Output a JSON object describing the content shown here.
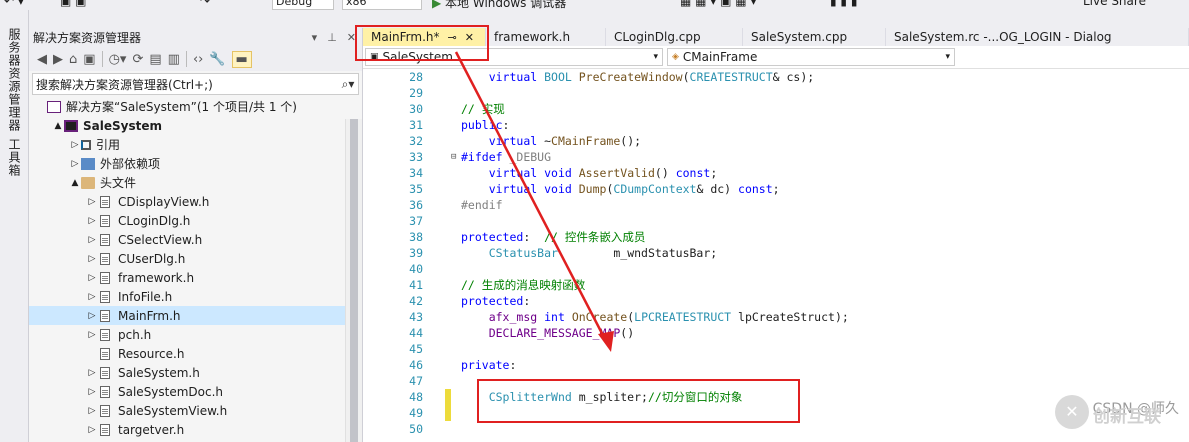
{
  "toolbar": {
    "config": "Debug",
    "platform": "x86",
    "debugger": "本地 Windows 调试器",
    "liveshare": "Live Share"
  },
  "left_tabs": [
    "服务器资源管理器",
    "工具箱"
  ],
  "solution_explorer": {
    "title": "解决方案资源管理器",
    "search_placeholder": "搜索解决方案资源管理器(Ctrl+;)",
    "items": [
      {
        "label": "解决方案“SaleSystem”(1 个项目/共 1 个)",
        "icon": "solution-icon",
        "indent": 0,
        "arrow": ""
      },
      {
        "label": "SaleSystem",
        "icon": "project-icon",
        "indent": 1,
        "arrow": "▲",
        "bold": true
      },
      {
        "label": "引用",
        "icon": "references-icon",
        "indent": 2,
        "arrow": "▷"
      },
      {
        "label": "外部依赖项",
        "icon": "external-deps-icon",
        "indent": 2,
        "arrow": "▷"
      },
      {
        "label": "头文件",
        "icon": "folder-icon",
        "indent": 2,
        "arrow": "▲"
      },
      {
        "label": "CDisplayView.h",
        "icon": "header-file-icon",
        "indent": 3,
        "arrow": "▷"
      },
      {
        "label": "CLoginDlg.h",
        "icon": "header-file-icon",
        "indent": 3,
        "arrow": "▷"
      },
      {
        "label": "CSelectView.h",
        "icon": "header-file-icon",
        "indent": 3,
        "arrow": "▷"
      },
      {
        "label": "CUserDlg.h",
        "icon": "header-file-icon",
        "indent": 3,
        "arrow": "▷"
      },
      {
        "label": "framework.h",
        "icon": "header-file-icon",
        "indent": 3,
        "arrow": "▷"
      },
      {
        "label": "InfoFile.h",
        "icon": "header-file-icon",
        "indent": 3,
        "arrow": "▷"
      },
      {
        "label": "MainFrm.h",
        "icon": "header-file-icon",
        "indent": 3,
        "arrow": "▷",
        "selected": true
      },
      {
        "label": "pch.h",
        "icon": "header-file-icon",
        "indent": 3,
        "arrow": "▷"
      },
      {
        "label": "Resource.h",
        "icon": "header-file-icon",
        "indent": 3,
        "arrow": ""
      },
      {
        "label": "SaleSystem.h",
        "icon": "header-file-icon",
        "indent": 3,
        "arrow": "▷"
      },
      {
        "label": "SaleSystemDoc.h",
        "icon": "header-file-icon",
        "indent": 3,
        "arrow": "▷"
      },
      {
        "label": "SaleSystemView.h",
        "icon": "header-file-icon",
        "indent": 3,
        "arrow": "▷"
      },
      {
        "label": "targetver.h",
        "icon": "header-file-icon",
        "indent": 3,
        "arrow": "▷"
      }
    ]
  },
  "editor": {
    "tabs": [
      {
        "label": "MainFrm.h*",
        "active": true,
        "pin": "⊸",
        "close": "✕"
      },
      {
        "label": "framework.h"
      },
      {
        "label": "CLoginDlg.cpp"
      },
      {
        "label": "SaleSystem.cpp"
      },
      {
        "label": "SaleSystem.rc -...OG_LOGIN - Dialog"
      }
    ],
    "nav_project": "SaleSystem",
    "nav_class": "CMainFrame",
    "lines": [
      {
        "n": "28",
        "html": "    <span class='kw'>virtual</span> <span class='ty'>BOOL</span> <span class='fn'>PreCreateWindow</span>(<span class='ty'>CREATESTRUCT</span>&amp; cs);"
      },
      {
        "n": "29",
        "html": ""
      },
      {
        "n": "30",
        "html": "<span class='cm'>// 实现</span>"
      },
      {
        "n": "31",
        "html": "<span class='kw'>public</span>:"
      },
      {
        "n": "32",
        "html": "    <span class='kw'>virtual</span> ~<span class='fn'>CMainFrame</span>();"
      },
      {
        "n": "33",
        "html": "<span class='kw'>#ifdef</span> <span class='pp'>_DEBUG</span>"
      },
      {
        "n": "34",
        "html": "    <span class='kw'>virtual</span> <span class='kw'>void</span> <span class='fn'>AssertValid</span>() <span class='kw'>const</span>;"
      },
      {
        "n": "35",
        "html": "    <span class='kw'>virtual</span> <span class='kw'>void</span> <span class='fn'>Dump</span>(<span class='ty'>CDumpContext</span>&amp; dc) <span class='kw'>const</span>;"
      },
      {
        "n": "36",
        "html": "<span class='pp'>#endif</span>"
      },
      {
        "n": "37",
        "html": ""
      },
      {
        "n": "38",
        "html": "<span class='kw'>protected</span>:  <span class='cm'>// 控件条嵌入成员</span>"
      },
      {
        "n": "39",
        "html": "    <span class='ty'>CStatusBar</span>        m_wndStatusBar;"
      },
      {
        "n": "40",
        "html": ""
      },
      {
        "n": "41",
        "html": "<span class='cm'>// 生成的消息映射函数</span>"
      },
      {
        "n": "42",
        "html": "<span class='kw'>protected</span>:"
      },
      {
        "n": "43",
        "html": "    <span class='mac'>afx_msg</span> <span class='kw'>int</span> <span class='fn'>OnCreate</span>(<span class='ty'>LPCREATESTRUCT</span> lpCreateStruct);"
      },
      {
        "n": "44",
        "html": "    <span class='mac'>DECLARE_MESSAGE_MAP</span>()"
      },
      {
        "n": "45",
        "html": ""
      },
      {
        "n": "46",
        "html": "<span class='kw'>private</span>:"
      },
      {
        "n": "47",
        "html": ""
      },
      {
        "n": "48",
        "html": "    <span class='ty'>CSplitterWnd</span> m_spliter;<span class='cm'>//切分窗口的对象</span>"
      },
      {
        "n": "49",
        "html": ""
      },
      {
        "n": "50",
        "html": ""
      }
    ]
  },
  "watermark": "CSDN @师久",
  "logo_text": "创新互联",
  "colors": {
    "accent": "#007acc",
    "annotation_red": "#e02020",
    "tab_active": "#fff1a6",
    "selection": "#cce8ff"
  }
}
